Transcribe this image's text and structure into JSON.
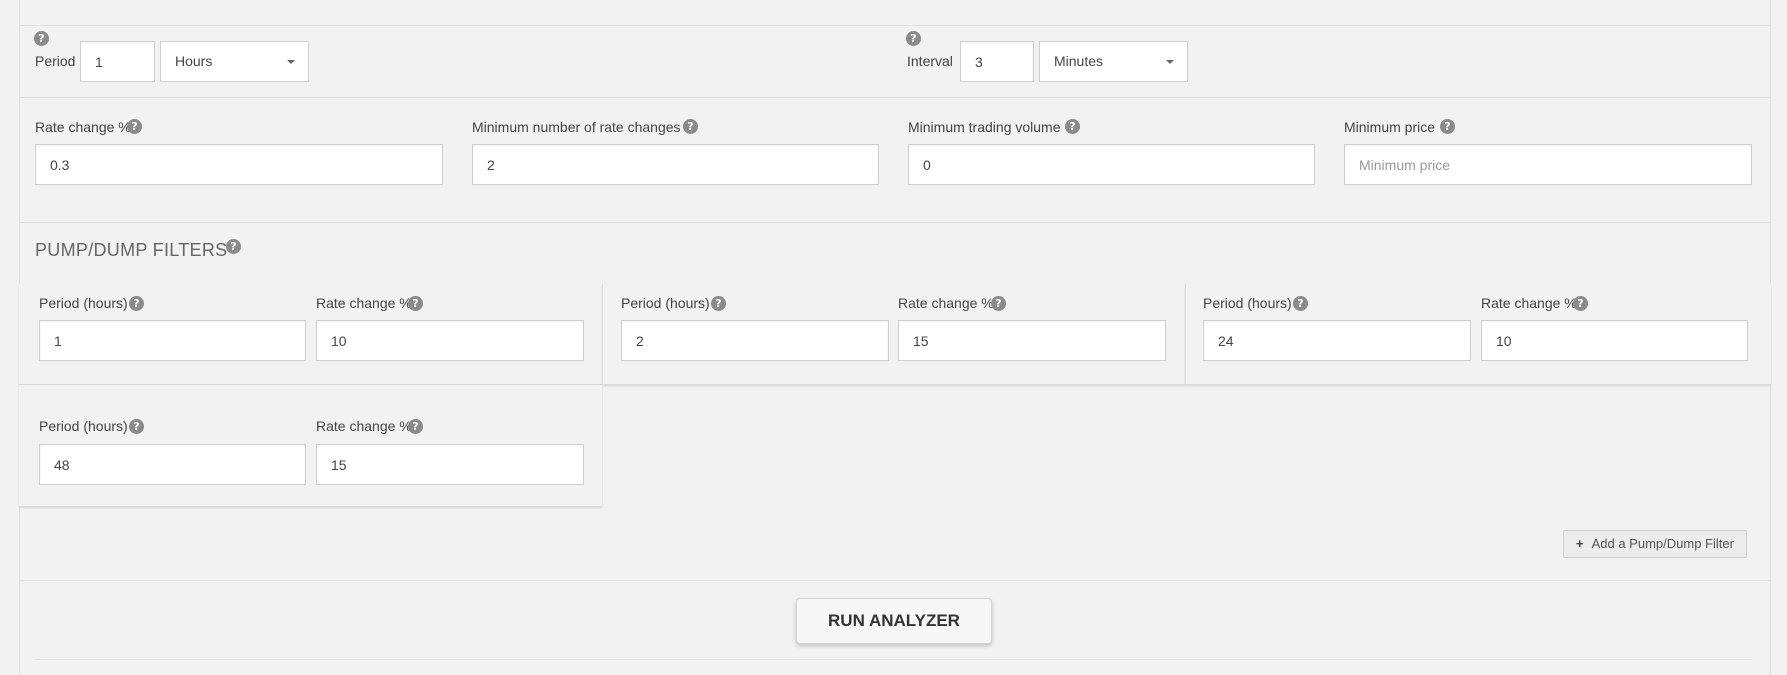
{
  "help_glyph": "?",
  "period": {
    "label": "Period",
    "value": "1",
    "unit": "Hours"
  },
  "interval": {
    "label": "Interval",
    "value": "3",
    "unit": "Minutes"
  },
  "rate_change": {
    "label": "Rate change %",
    "value": "0.3"
  },
  "min_rate_changes": {
    "label": "Minimum number of rate changes",
    "value": "2"
  },
  "min_volume": {
    "label": "Minimum trading volume",
    "value": "0"
  },
  "min_price": {
    "label": "Minimum price",
    "value": "",
    "placeholder": "Minimum price"
  },
  "pump_dump": {
    "title": "PUMP/DUMP FILTERS",
    "period_label": "Period (hours)",
    "rate_label": "Rate change %",
    "filters": [
      {
        "period": "1",
        "rate": "10"
      },
      {
        "period": "2",
        "rate": "15"
      },
      {
        "period": "24",
        "rate": "10"
      },
      {
        "period": "48",
        "rate": "15"
      }
    ],
    "add_label": "Add a Pump/Dump Filter",
    "add_icon": "plus-icon"
  },
  "run_label": "RUN ANALYZER"
}
